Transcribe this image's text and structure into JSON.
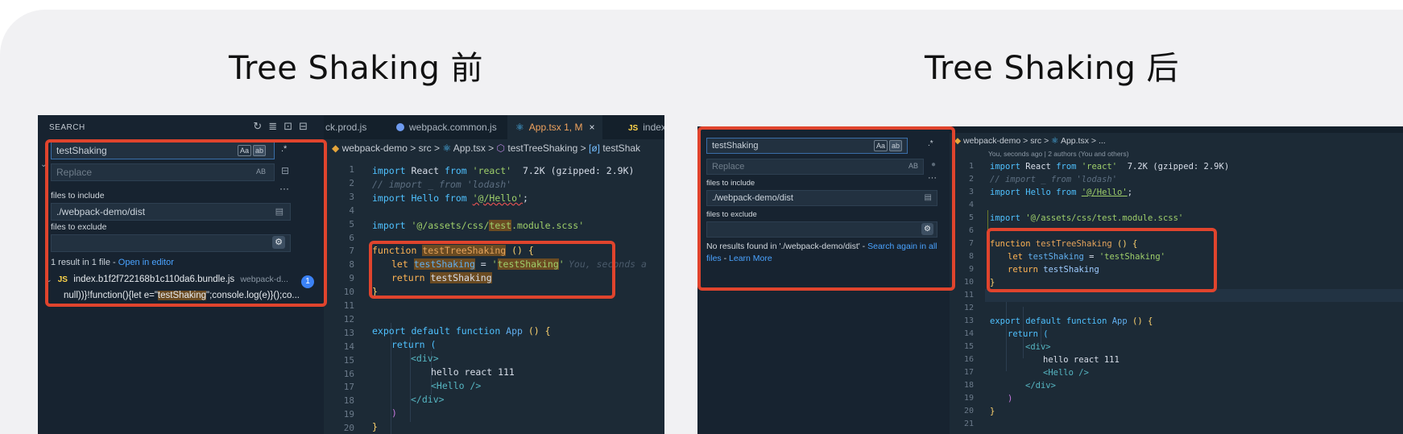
{
  "titles": {
    "before": "Tree Shaking 前",
    "after": "Tree Shaking 后"
  },
  "left": {
    "search_header": "SEARCH",
    "search_value": "testShaking",
    "replace_placeholder": "Replace",
    "opt_case": "Aa",
    "opt_word": "ab",
    "opt_preserve": "AB",
    "files_include_label": "files to include",
    "files_include_value": "./webpack-demo/dist",
    "files_exclude_label": "files to exclude",
    "result_summary": "1 result in 1 file - ",
    "open_in_editor": "Open in editor",
    "result_js_tag": "JS",
    "result_file": "index.b1f2f722168b1c110da6.bundle.js",
    "result_path": "webpack-d...",
    "result_count": "1",
    "result_snippet_pre": "null))}!function(){let e=\"",
    "result_snippet_match": "testShaking",
    "result_snippet_post": "\";console.log(e)}();co...",
    "tabs": [
      "ck.prod.js",
      "webpack.common.js",
      "App.tsx 1, M",
      "index"
    ],
    "tab_close": "×",
    "tab_js_tag": "JS",
    "crumb_folder": "webpack-demo",
    "crumb_src": "src",
    "crumb_file": "App.tsx",
    "crumb_fn": "testTreeShaking",
    "crumb_var": "testShak",
    "crumb_sep": ">",
    "inline_blame": "You, seconds a",
    "line_numbers": [
      "1",
      "2",
      "3",
      "4",
      "5",
      "6",
      "7",
      "8",
      "9",
      "10",
      "11",
      "12",
      "13",
      "14",
      "15",
      "16",
      "17",
      "18",
      "19",
      "20"
    ],
    "code": {
      "l1_import": "import",
      "l1_react": " React ",
      "l1_from": "from",
      "l1_str": " 'react'",
      "l1_size": "  7.2K (gzipped: 2.9K)",
      "l2": "// import _ from 'lodash'",
      "l3_a": "import Hello from ",
      "l3_b": "'@/Hello'",
      "l3_c": ";",
      "l5_a": "import ",
      "l5_b": "'@/assets/css/",
      "l5_c": "test",
      "l5_d": ".module.scss'",
      "l7_a": "function ",
      "l7_b": "testTreeShaking",
      "l7_c": " () {",
      "l8_a": "let ",
      "l8_b": "testShaking",
      "l8_c": " = ",
      "l8_d": "'",
      "l8_e": "testShaking",
      "l8_f": "'",
      "l9_a": "return ",
      "l9_b": "testShaking",
      "l10": "}",
      "l13_a": "export default function ",
      "l13_b": "App",
      "l13_c": " () {",
      "l14": "return (",
      "l15": "<div>",
      "l16": "hello react 111",
      "l17": "<Hello />",
      "l18": "</div>",
      "l19": ")",
      "l20": "}"
    }
  },
  "right": {
    "search_value": "testShaking",
    "replace_placeholder": "Replace",
    "opt_case": "Aa",
    "opt_word": "ab",
    "opt_preserve": "AB",
    "files_include_label": "files to include",
    "files_include_value": "./webpack-demo/dist",
    "files_exclude_label": "files to exclude",
    "no_results": "No results found in './webpack-demo/dist' - ",
    "search_again": "Search again in all files",
    "sep": " - ",
    "learn_more": "Learn More",
    "crumb_folder": "webpack-demo",
    "crumb_src": "src",
    "crumb_file": "App.tsx",
    "crumb_more": "...",
    "crumb_sep": ">",
    "blame_header": "You, seconds ago | 2 authors (You and others)",
    "line_numbers": [
      "1",
      "2",
      "3",
      "4",
      "5",
      "6",
      "7",
      "8",
      "9",
      "10",
      "11",
      "12",
      "13",
      "14",
      "15",
      "16",
      "17",
      "18",
      "19",
      "20",
      "21"
    ],
    "code": {
      "l1_import": "import",
      "l1_react": " React ",
      "l1_from": "from",
      "l1_str": " 'react'",
      "l1_size": "  7.2K (gzipped: 2.9K)",
      "l2": "// import _ from 'lodash'",
      "l3_a": "import Hello from ",
      "l3_b": "'@/Hello'",
      "l3_c": ";",
      "l5_a": "import ",
      "l5_b": "'@/assets/css/test.module.scss'",
      "l7_a": "function ",
      "l7_b": "testTreeShaking",
      "l7_c": " () {",
      "l8_a": "let ",
      "l8_b": "testShaking",
      "l8_c": " = ",
      "l8_d": "'testShaking'",
      "l9_a": "return ",
      "l9_b": "testShaking",
      "l10": "}",
      "l13_a": "export default function ",
      "l13_b": "App",
      "l13_c": " () {",
      "l14": "return (",
      "l15": "<div>",
      "l16": "hello react 111",
      "l17": "<Hello />",
      "l18": "</div>",
      "l19": ")",
      "l20": "}"
    }
  }
}
